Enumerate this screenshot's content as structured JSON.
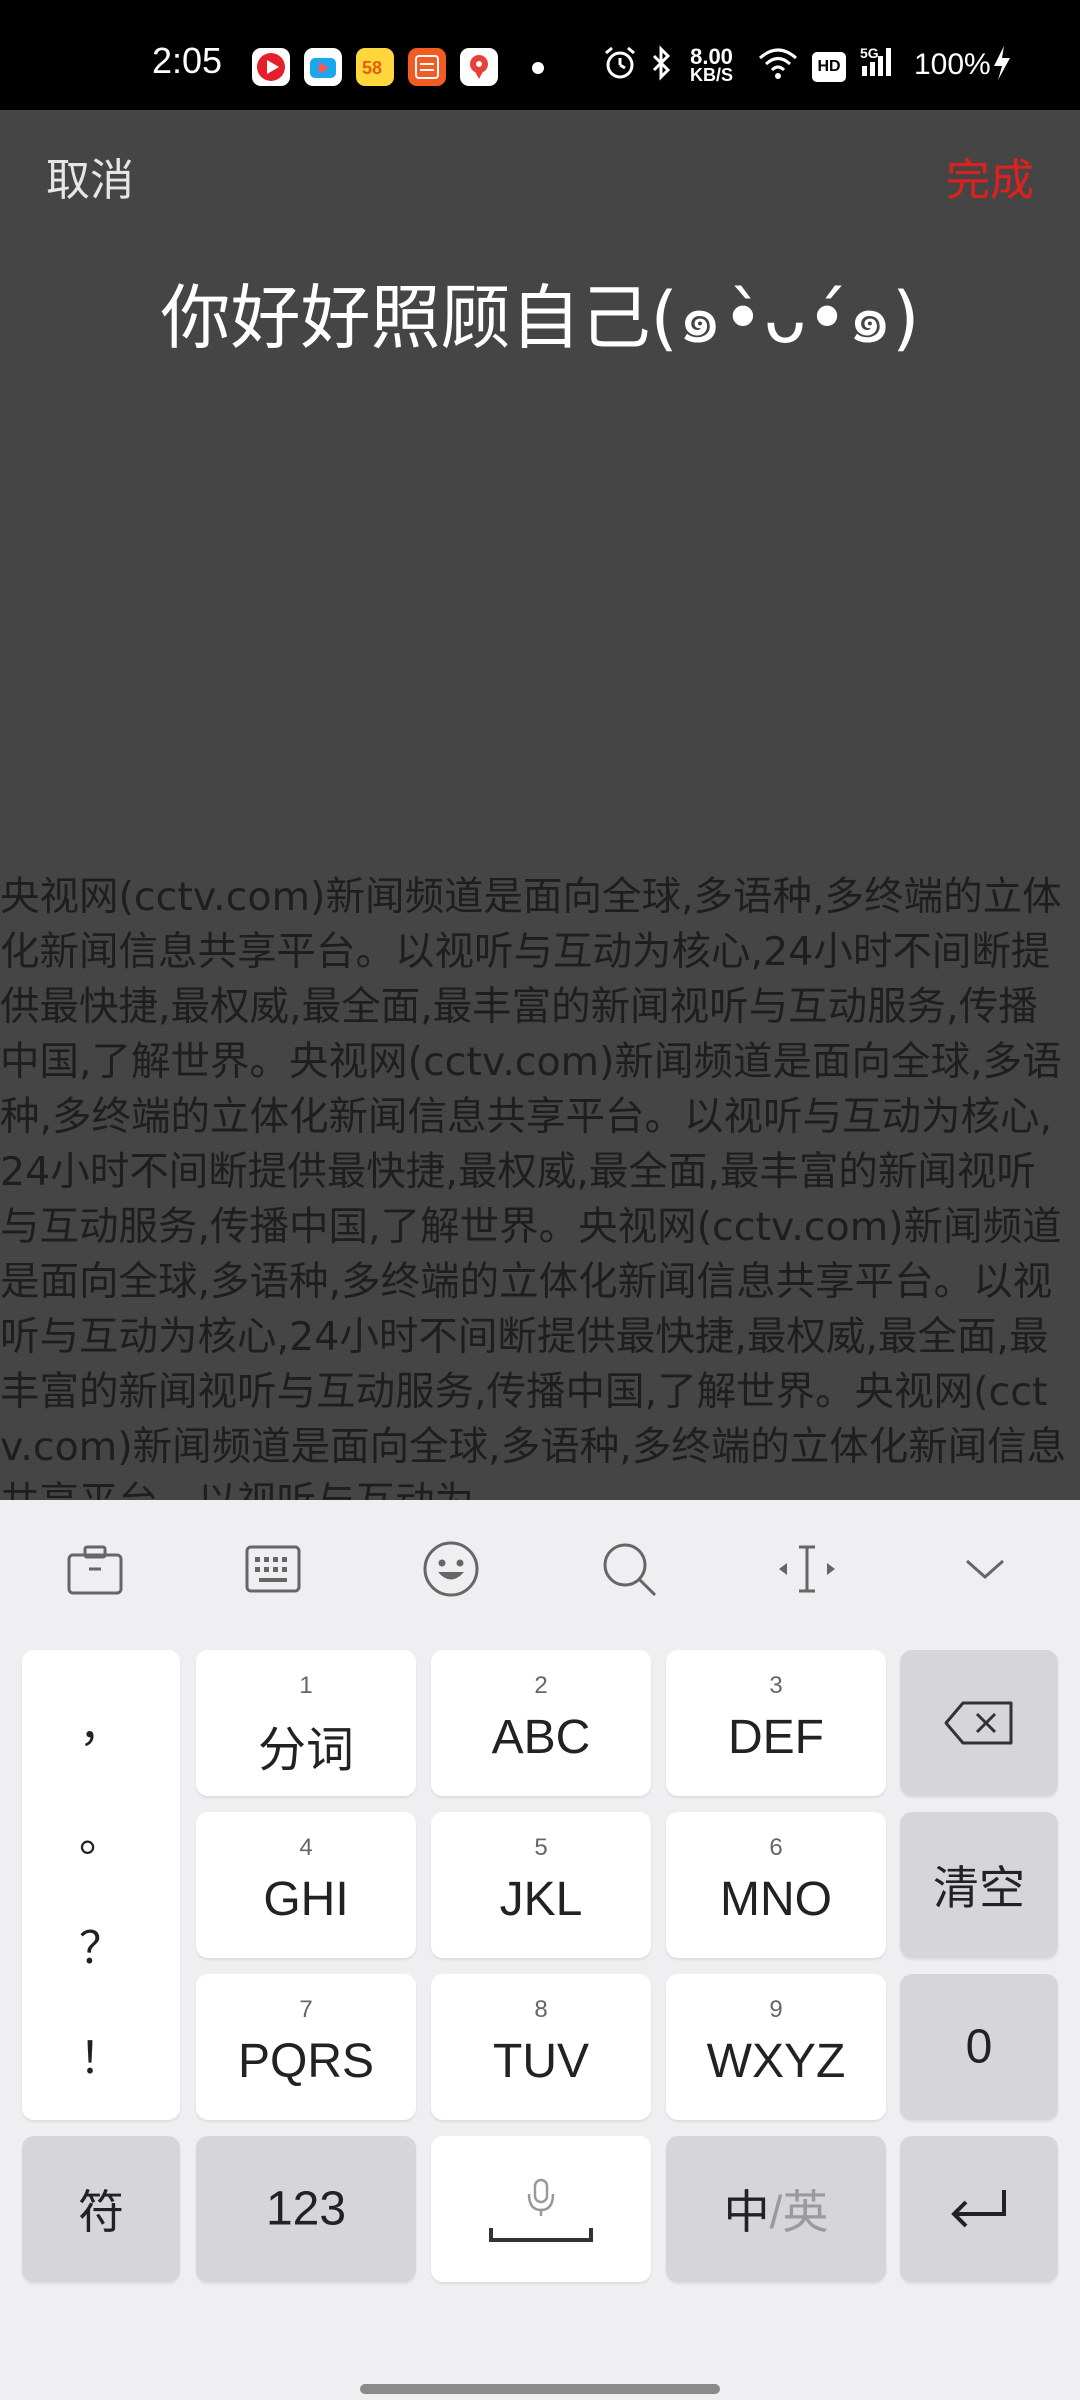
{
  "status_bar": {
    "time": "2:05",
    "net_speed_value": "8.00",
    "net_speed_unit": "KB/S",
    "hd": "HD",
    "signal": "5G",
    "battery": "100%",
    "notification_apps": [
      "video-app-icon",
      "bilibili-style-icon",
      "58-app-icon",
      "ranking-app-icon",
      "map-app-icon"
    ]
  },
  "header": {
    "cancel": "取消",
    "done": "完成",
    "preview_text": "你好好照顾自己(๑•̀ᴗ•́๑)"
  },
  "article": {
    "text": "央视网(cctv.com)新闻频道是面向全球,多语种,多终端的立体化新闻信息共享平台。以视听与互动为核心,24小时不间断提供最快捷,最权威,最全面,最丰富的新闻视听与互动服务,传播中国,了解世界。央视网(cctv.com)新闻频道是面向全球,多语种,多终端的立体化新闻信息共享平台。以视听与互动为核心,24小时不间断提供最快捷,最权威,最全面,最丰富的新闻视听与互动服务,传播中国,了解世界。央视网(cctv.com)新闻频道是面向全球,多语种,多终端的立体化新闻信息共享平台。以视听与互动为核心,24小时不间断提供最快捷,最权威,最全面,最丰富的新闻视听与互动服务,传播中国,了解世界。央视网(cctv.com)新闻频道是面向全球,多语种,多终端的立体化新闻信息共享平台。以视听与互动为"
  },
  "keyboard": {
    "toolbar": [
      "clipboard-icon",
      "keyboard-layout-icon",
      "emoji-icon",
      "search-icon",
      "cursor-icon",
      "collapse-icon"
    ],
    "punctuation": [
      "，",
      "。",
      "？",
      "！"
    ],
    "keys": {
      "k1": {
        "num": "1",
        "label": "分词"
      },
      "k2": {
        "num": "2",
        "label": "ABC"
      },
      "k3": {
        "num": "3",
        "label": "DEF"
      },
      "k4": {
        "num": "4",
        "label": "GHI"
      },
      "k5": {
        "num": "5",
        "label": "JKL"
      },
      "k6": {
        "num": "6",
        "label": "MNO"
      },
      "k7": {
        "num": "7",
        "label": "PQRS"
      },
      "k8": {
        "num": "8",
        "label": "TUV"
      },
      "k9": {
        "num": "9",
        "label": "WXYZ"
      }
    },
    "clear": "清空",
    "zero": "0",
    "symbols": "符",
    "numeric": "123",
    "lang_primary": "中",
    "lang_secondary": "/英"
  },
  "colors": {
    "accent_done": "#e0201c",
    "background": "#454545",
    "keyboard_bg": "#efeff1"
  }
}
